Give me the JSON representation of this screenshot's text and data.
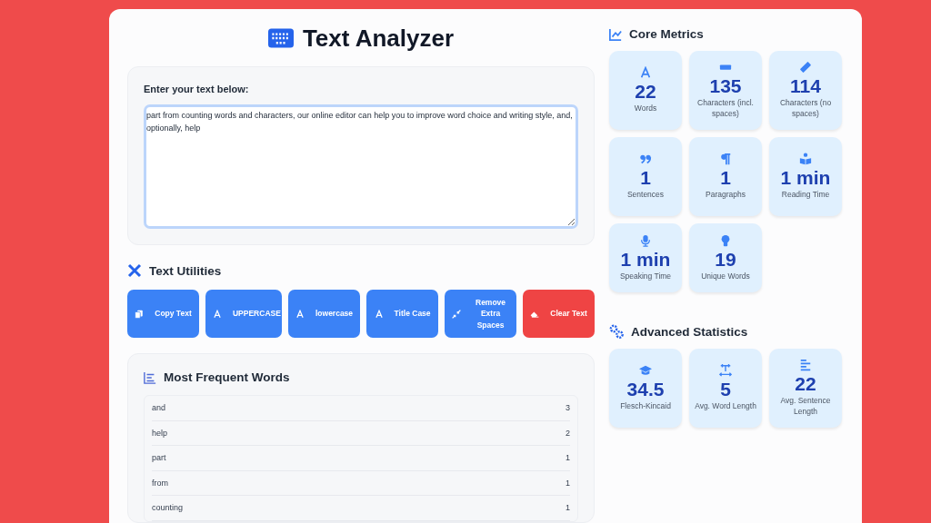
{
  "title": "Text Analyzer",
  "input": {
    "label": "Enter your text below:",
    "value": "part from counting words and characters, our online editor can help you to improve word choice and writing style, and, optionally, help"
  },
  "utilities": {
    "heading": "Text Utilities",
    "buttons": [
      {
        "label": "Copy Text",
        "kind": "primary"
      },
      {
        "label": "UPPERCASE",
        "kind": "primary"
      },
      {
        "label": "lowercase",
        "kind": "primary"
      },
      {
        "label": "Title Case",
        "kind": "primary"
      },
      {
        "label": "Remove Extra Spaces",
        "kind": "primary"
      },
      {
        "label": "Clear Text",
        "kind": "danger"
      }
    ]
  },
  "frequent_words": {
    "heading": "Most Frequent Words",
    "rows": [
      {
        "word": "and",
        "count": "3"
      },
      {
        "word": "help",
        "count": "2"
      },
      {
        "word": "part",
        "count": "1"
      },
      {
        "word": "from",
        "count": "1"
      },
      {
        "word": "counting",
        "count": "1"
      }
    ]
  },
  "core_metrics": {
    "heading": "Core Metrics",
    "tiles": [
      {
        "value": "22",
        "label": "Words"
      },
      {
        "value": "135",
        "label": "Characters (incl. spaces)"
      },
      {
        "value": "114",
        "label": "Characters (no spaces)"
      },
      {
        "value": "1",
        "label": "Sentences"
      },
      {
        "value": "1",
        "label": "Paragraphs"
      },
      {
        "value": "1 min",
        "label": "Reading Time"
      },
      {
        "value": "1 min",
        "label": "Speaking Time"
      },
      {
        "value": "19",
        "label": "Unique Words"
      }
    ]
  },
  "advanced_statistics": {
    "heading": "Advanced Statistics",
    "tiles": [
      {
        "value": "34.5",
        "label": "Flesch-Kincaid"
      },
      {
        "value": "5",
        "label": "Avg. Word Length"
      },
      {
        "value": "22",
        "label": "Avg. Sentence Length"
      }
    ]
  }
}
